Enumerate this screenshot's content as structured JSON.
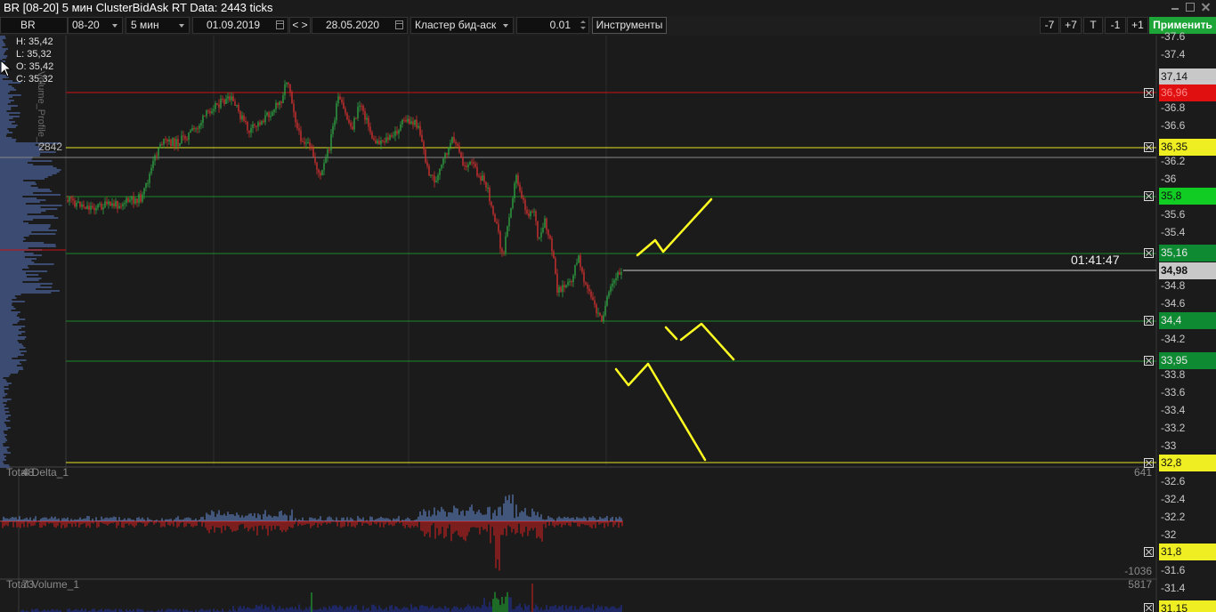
{
  "window": {
    "title": "BR [08-20] 5 мин ClusterBidAsk RT Data: 2443 ticks"
  },
  "toolbar": {
    "symbol": "BR",
    "contract": "08-20",
    "timeframe": "5 мин",
    "date_from": "01.09.2019",
    "nav_label": "< >",
    "date_to": "28.05.2020",
    "chart_type": "Кластер бид-аск",
    "step": "0.01",
    "tools_label": "Инструменты",
    "zoom_buttons": [
      "-7",
      "+7",
      "T",
      "-1",
      "+1"
    ],
    "apply_label": "Применить"
  },
  "ohlc": {
    "high": "H: 35,42",
    "low": "L: 35,32",
    "open": "O: 35,42",
    "close": "C: 35,32"
  },
  "volume_profile": {
    "label": "Volume_Profile_1",
    "level_value": "2842"
  },
  "countdown": "01:41:47",
  "price_axis": {
    "ticks": [
      "-37.6",
      "-37.4",
      "-36.8",
      "-36.6",
      "-36.2",
      "-36",
      "-35.6",
      "-35.4",
      "-34.8",
      "-34.6",
      "-34.2",
      "-33.8",
      "-33.6",
      "-33.4",
      "-33.2",
      "-33",
      "-32.6",
      "-32.4",
      "-32.2",
      "-32",
      "-31.6",
      "-31.4"
    ]
  },
  "price_tags": [
    {
      "label": "37,14",
      "bg": "#c8c8c8",
      "fg": "#111111"
    },
    {
      "label": "36,96",
      "bg": "#e01010",
      "fg": "#ff8a8a"
    },
    {
      "label": "36,35",
      "bg": "#eeee22",
      "fg": "#111111"
    },
    {
      "label": "35,8",
      "bg": "#11cc22",
      "fg": "#111111"
    },
    {
      "label": "35,16",
      "bg": "#0e8a33",
      "fg": "#e8e8e8"
    },
    {
      "label": "34,98",
      "bg": "#c8c8c8",
      "fg": "#111111"
    },
    {
      "label": "34,4",
      "bg": "#0e8a33",
      "fg": "#e8e8e8"
    },
    {
      "label": "33,95",
      "bg": "#0e8a33",
      "fg": "#e8e8e8"
    },
    {
      "label": "32,8",
      "bg": "#eeee22",
      "fg": "#111111"
    },
    {
      "label": "31,8",
      "bg": "#eeee22",
      "fg": "#111111"
    },
    {
      "label": "31,15",
      "bg": "#eeee22",
      "fg": "#111111"
    }
  ],
  "delta_pane": {
    "label": "Total Delta_1",
    "left_value": "48",
    "max_value": "641",
    "min_value": "-1036"
  },
  "volume_pane": {
    "label": "Total Volume_1",
    "left_value": "73",
    "max_value": "5817"
  },
  "colors": {
    "support": "#1a8a2a",
    "resistance_red": "#cc1111",
    "yellow_level": "#e6e620",
    "annotation": "#ffff22",
    "candle_up": "#2ea043",
    "candle_down": "#d03030",
    "delta_pos": "#6a8fd8",
    "delta_neg": "#dd2020"
  }
}
